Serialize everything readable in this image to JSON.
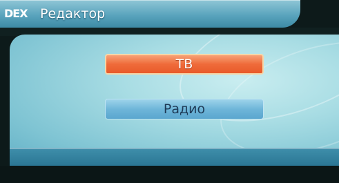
{
  "header": {
    "logo": "DEX",
    "title": "Редактор"
  },
  "menu": {
    "items": [
      {
        "label": "ТВ",
        "state": "selected"
      },
      {
        "label": "Радио",
        "state": "normal"
      }
    ]
  },
  "colors": {
    "selected": "#ef6b3a",
    "normal": "#6fb6d9",
    "panel": "#a9dde4"
  }
}
